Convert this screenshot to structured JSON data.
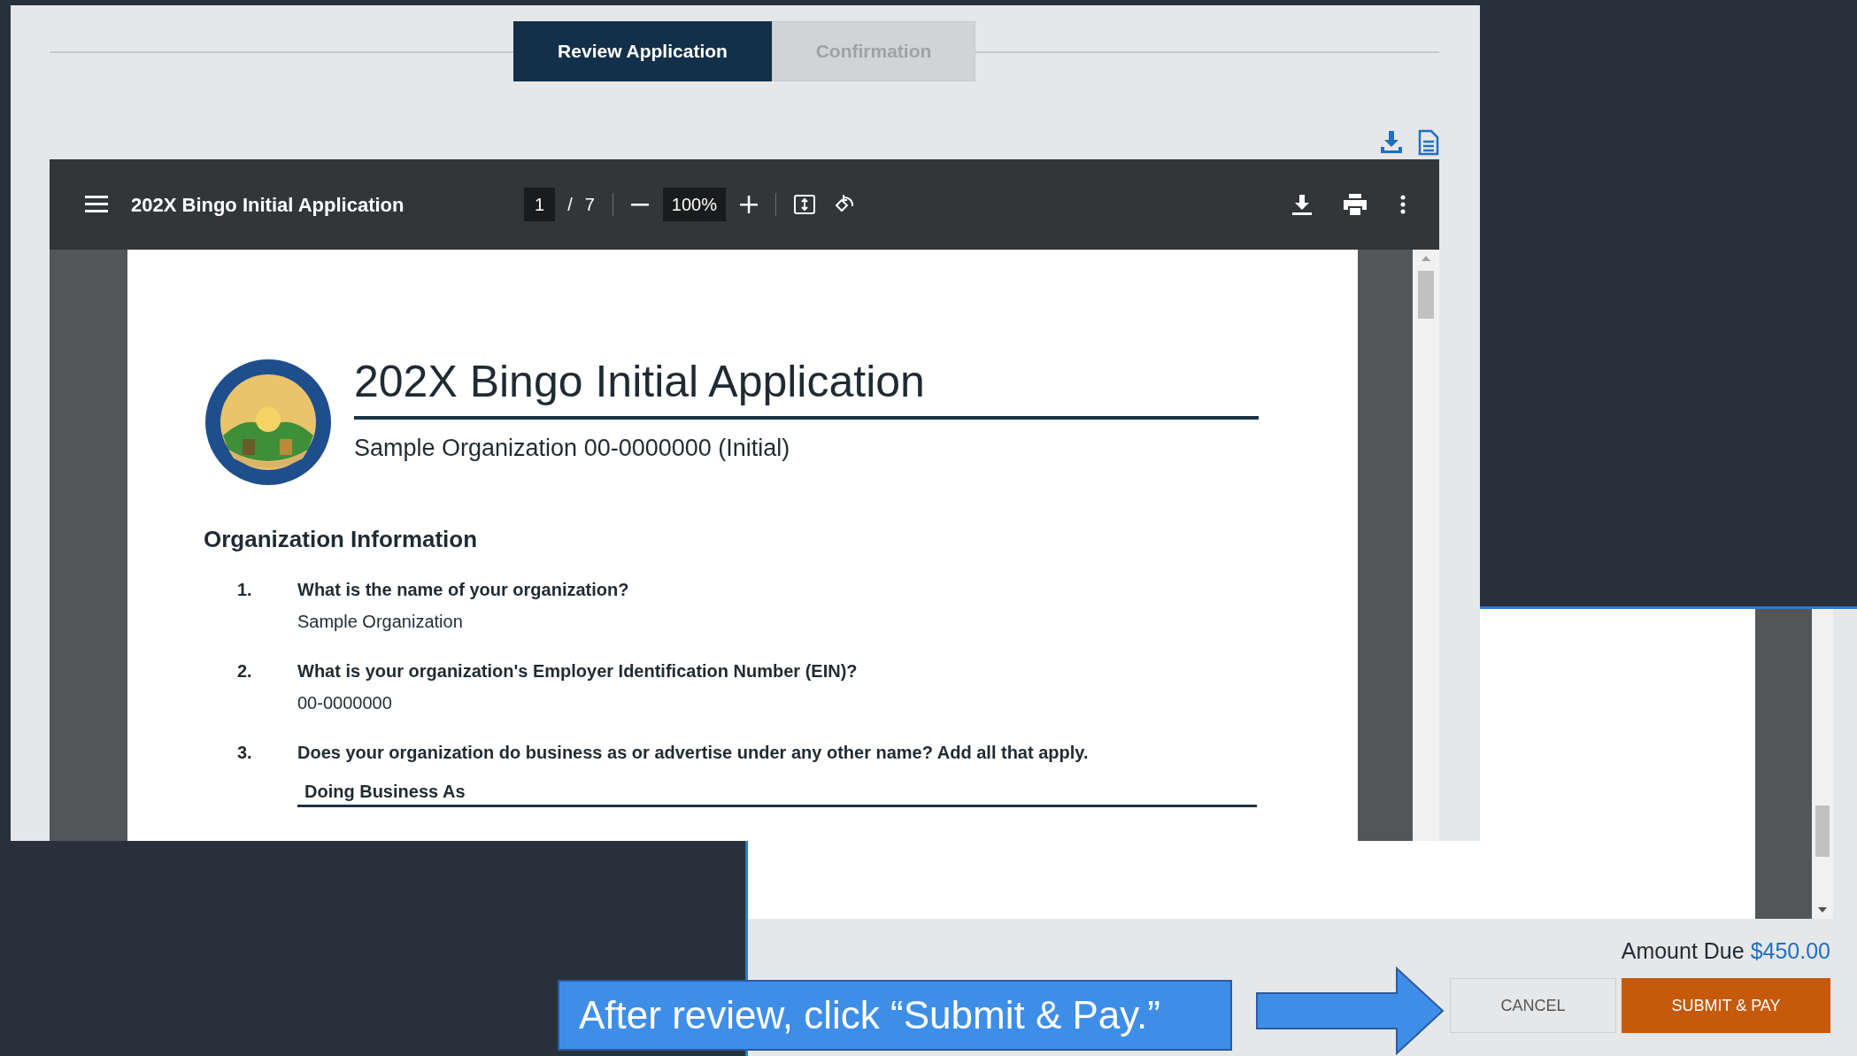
{
  "tabs": [
    {
      "label": "Review Application",
      "selected": true
    },
    {
      "label": "Confirmation",
      "selected": false
    }
  ],
  "viewer": {
    "title": "202X Bingo Initial Application",
    "page": "1",
    "page_separator": "/",
    "page_count": "7",
    "zoom": "100%"
  },
  "document": {
    "title": "202X Bingo Initial Application",
    "subtitle": "Sample Organization 00-0000000 (Initial)",
    "section": "Organization Information",
    "questions": [
      {
        "number": "1.",
        "text": "What is the name of your organization?",
        "answer": "Sample Organization"
      },
      {
        "number": "2.",
        "text": "What is your organization's Employer Identification Number (EIN)?",
        "answer": "00-0000000"
      },
      {
        "number": "3.",
        "text": "Does your organization do business as or advertise under any other name? Add all that apply."
      }
    ],
    "table_header": "Doing Business As"
  },
  "footer": {
    "amount_label": "Amount Due",
    "amount": "$450.00"
  },
  "buttons": [
    {
      "label": "CANCEL",
      "kind": "secondary"
    },
    {
      "label": "SUBMIT & PAY",
      "kind": "primary"
    }
  ],
  "callout": {
    "text": "After review, click “Submit & Pay.”"
  }
}
